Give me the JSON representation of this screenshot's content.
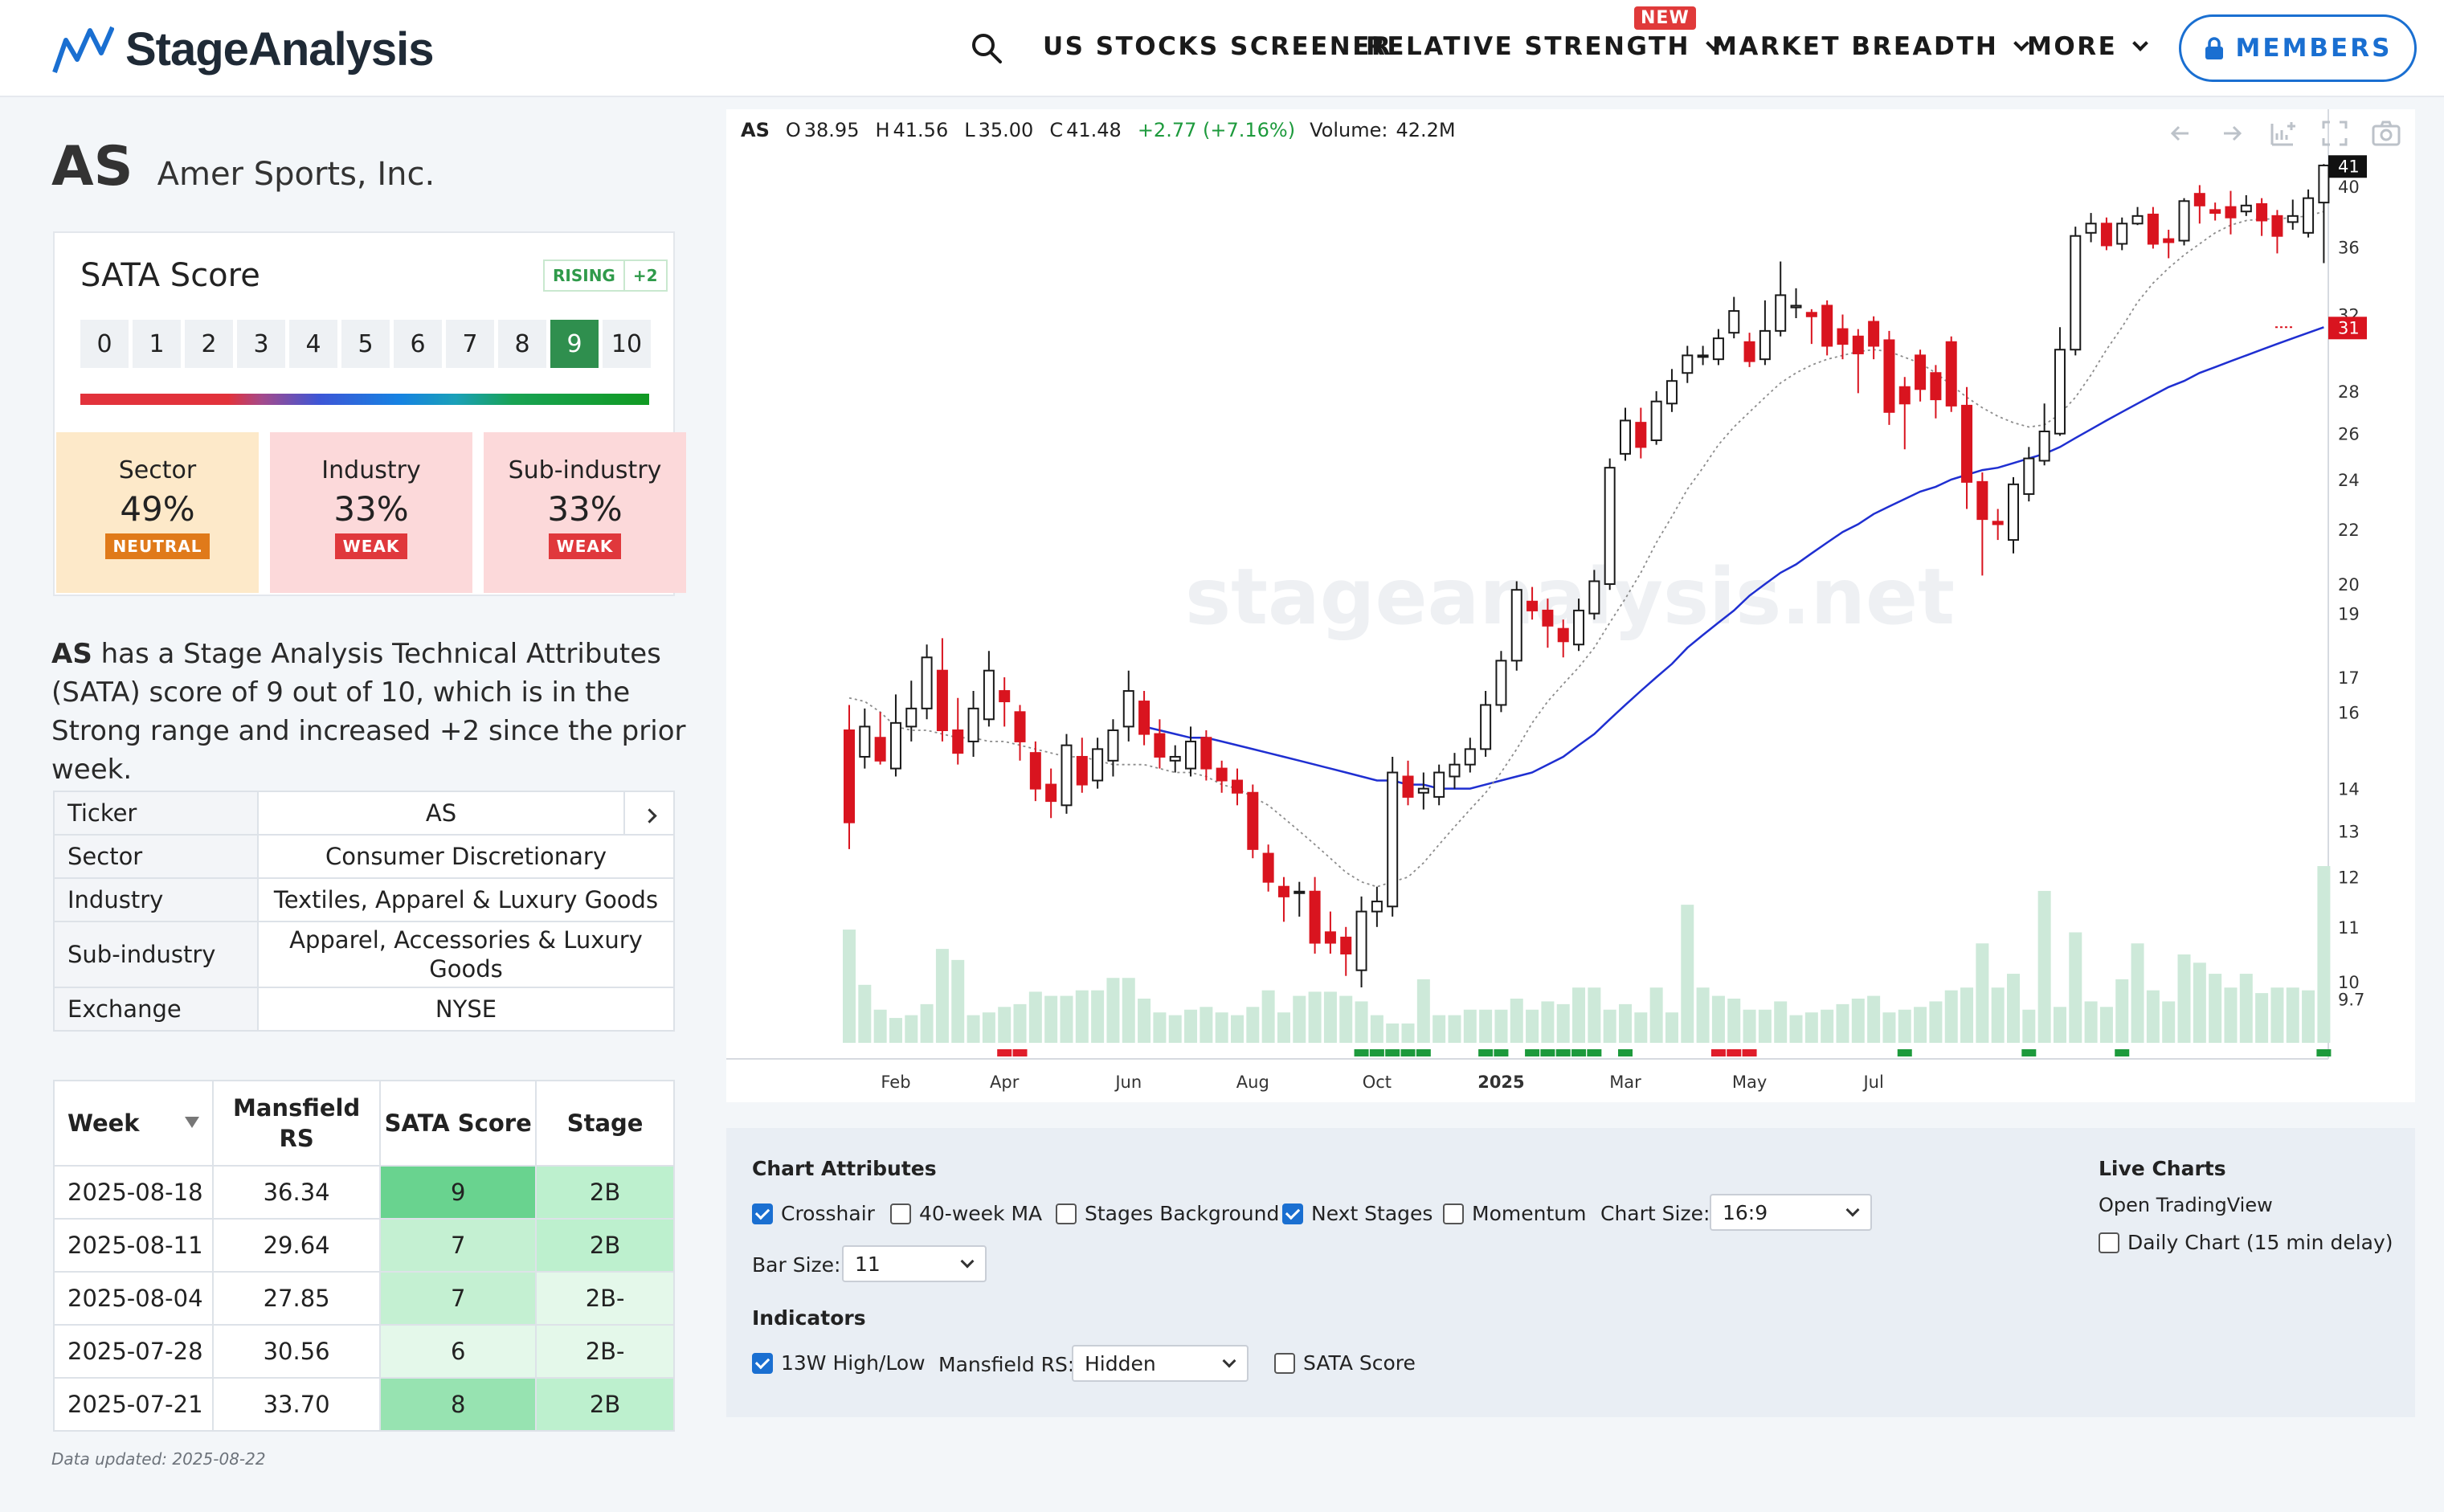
{
  "nav": {
    "logo": "StageAnalysis",
    "items": [
      {
        "label": "US STOCKS SCREENER",
        "has_chevron": false
      },
      {
        "label": "RELATIVE STRENGTH",
        "has_chevron": true,
        "badge": "NEW"
      },
      {
        "label": "MARKET BREADTH",
        "has_chevron": true
      },
      {
        "label": "MORE",
        "has_chevron": true
      }
    ],
    "members": "MEMBERS"
  },
  "ticker": {
    "symbol": "AS",
    "name": "Amer Sports, Inc."
  },
  "sata": {
    "label": "SATA Score",
    "trend": "RISING",
    "trend_change": "+2",
    "scale": [
      "0",
      "1",
      "2",
      "3",
      "4",
      "5",
      "6",
      "7",
      "8",
      "9",
      "10"
    ],
    "score": 9,
    "groups": [
      {
        "name": "Sector",
        "value": "49%",
        "badge": "NEUTRAL",
        "bg": "#fde9c9",
        "badge_color": "#e07a1a"
      },
      {
        "name": "Industry",
        "value": "33%",
        "badge": "WEAK",
        "bg": "#fcd9da",
        "badge_color": "#e0383c"
      },
      {
        "name": "Sub-industry",
        "value": "33%",
        "badge": "WEAK",
        "bg": "#fcd9da",
        "badge_color": "#e0383c"
      }
    ]
  },
  "description": {
    "symbol": "AS",
    "text": " has a Stage Analysis Technical Attributes (SATA) score of 9 out of 10, which is in the Strong range and increased +2 since the prior week."
  },
  "info": [
    {
      "key": "Ticker",
      "value": "AS"
    },
    {
      "key": "Sector",
      "value": "Consumer Discretionary"
    },
    {
      "key": "Industry",
      "value": "Textiles, Apparel & Luxury Goods"
    },
    {
      "key": "Sub-industry",
      "value": "Apparel, Accessories & Luxury Goods"
    },
    {
      "key": "Exchange",
      "value": "NYSE"
    }
  ],
  "weeks": {
    "headers": [
      "Week",
      "Mansfield RS",
      "SATA Score",
      "Stage"
    ],
    "rows": [
      {
        "week": "2025-08-18",
        "rs": "36.34",
        "score": "9",
        "stage": "2B",
        "score_bg": "#69d38f",
        "stage_bg": "#bdf0ce"
      },
      {
        "week": "2025-08-11",
        "rs": "29.64",
        "score": "7",
        "stage": "2B",
        "score_bg": "#c4f0d2",
        "stage_bg": "#bdf0ce"
      },
      {
        "week": "2025-08-04",
        "rs": "27.85",
        "score": "7",
        "stage": "2B-",
        "score_bg": "#c4f0d2",
        "stage_bg": "#e4f8ea"
      },
      {
        "week": "2025-07-28",
        "rs": "30.56",
        "score": "6",
        "stage": "2B-",
        "score_bg": "#e4f8ea",
        "stage_bg": "#e4f8ea"
      },
      {
        "week": "2025-07-21",
        "rs": "33.70",
        "score": "8",
        "stage": "2B",
        "score_bg": "#97e3b1",
        "stage_bg": "#bdf0ce"
      }
    ]
  },
  "data_updated": "Data updated: 2025-08-22",
  "chart": {
    "symbol": "AS",
    "o_label": "O",
    "o": "38.95",
    "h_label": "H",
    "h": "41.56",
    "l_label": "L",
    "l": "35.00",
    "c_label": "C",
    "c": "41.48",
    "change": "+2.77 (+7.16%)",
    "volume_label": "Volume:",
    "volume": "42.2M",
    "watermark": "stageanalysis.net",
    "last_price": "41",
    "ma_label": "31"
  },
  "chart_data": {
    "type": "candlestick",
    "x_ticks": [
      "Feb",
      "Apr",
      "Jun",
      "Aug",
      "Oct",
      "2025",
      "Mar",
      "May",
      "Jul"
    ],
    "y_ticks": [
      41,
      40,
      36,
      32,
      31,
      28,
      26,
      24,
      22,
      20,
      19,
      17,
      16,
      14,
      13,
      12,
      11,
      10,
      9.7
    ],
    "y_scale": "log",
    "candles": [
      [
        15.5,
        13.2,
        16.2,
        12.6
      ],
      [
        14.8,
        15.6,
        16.1,
        14.5
      ],
      [
        15.3,
        14.7,
        16.0,
        14.6
      ],
      [
        14.5,
        15.7,
        16.5,
        14.3
      ],
      [
        15.6,
        16.1,
        16.9,
        15.2
      ],
      [
        16.1,
        17.6,
        18.0,
        15.8
      ],
      [
        17.2,
        15.5,
        18.2,
        15.2
      ],
      [
        15.5,
        14.9,
        16.4,
        14.6
      ],
      [
        15.2,
        16.1,
        16.6,
        14.8
      ],
      [
        15.8,
        17.2,
        17.8,
        15.6
      ],
      [
        16.6,
        16.3,
        17.0,
        15.6
      ],
      [
        16.0,
        15.2,
        16.2,
        14.7
      ],
      [
        14.9,
        14.0,
        15.2,
        13.7
      ],
      [
        14.1,
        13.7,
        14.5,
        13.3
      ],
      [
        13.6,
        15.1,
        15.4,
        13.4
      ],
      [
        14.8,
        14.1,
        15.3,
        13.9
      ],
      [
        14.2,
        15.0,
        15.3,
        14.0
      ],
      [
        14.7,
        15.5,
        15.8,
        14.3
      ],
      [
        15.6,
        16.6,
        17.2,
        15.2
      ],
      [
        16.3,
        15.4,
        16.6,
        15.1
      ],
      [
        15.4,
        14.8,
        15.8,
        14.5
      ],
      [
        14.7,
        14.8,
        15.1,
        14.4
      ],
      [
        14.5,
        15.2,
        15.6,
        14.3
      ],
      [
        15.3,
        14.5,
        15.5,
        14.2
      ],
      [
        14.5,
        14.2,
        14.7,
        13.9
      ],
      [
        14.2,
        13.9,
        14.5,
        13.6
      ],
      [
        13.9,
        12.6,
        14.1,
        12.4
      ],
      [
        12.5,
        11.9,
        12.7,
        11.7
      ],
      [
        11.8,
        11.6,
        12.0,
        11.1
      ],
      [
        11.7,
        11.7,
        11.9,
        11.2
      ],
      [
        11.7,
        10.7,
        12.0,
        10.5
      ],
      [
        10.9,
        10.7,
        11.3,
        10.5
      ],
      [
        10.8,
        10.5,
        11.0,
        10.1
      ],
      [
        10.2,
        11.3,
        11.6,
        9.9
      ],
      [
        11.3,
        11.5,
        11.8,
        11.0
      ],
      [
        11.4,
        14.4,
        14.8,
        11.2
      ],
      [
        14.3,
        13.8,
        14.7,
        13.6
      ],
      [
        13.9,
        14.0,
        14.4,
        13.5
      ],
      [
        13.8,
        14.4,
        14.6,
        13.6
      ],
      [
        14.3,
        14.6,
        14.9,
        14.0
      ],
      [
        14.6,
        15.0,
        15.3,
        14.4
      ],
      [
        15.0,
        16.2,
        16.6,
        14.8
      ],
      [
        16.2,
        17.5,
        17.8,
        16.0
      ],
      [
        17.5,
        19.8,
        20.1,
        17.2
      ],
      [
        19.4,
        19.1,
        19.9,
        18.8
      ],
      [
        19.1,
        18.6,
        19.5,
        17.9
      ],
      [
        18.5,
        18.1,
        18.8,
        17.6
      ],
      [
        18.0,
        19.1,
        19.5,
        17.8
      ],
      [
        19.0,
        20.1,
        20.5,
        18.8
      ],
      [
        20.0,
        24.5,
        24.9,
        19.8
      ],
      [
        25.1,
        26.6,
        27.2,
        24.8
      ],
      [
        26.5,
        25.4,
        27.2,
        24.9
      ],
      [
        25.7,
        27.5,
        28.0,
        25.5
      ],
      [
        27.4,
        28.5,
        29.1,
        27.0
      ],
      [
        28.9,
        29.8,
        30.3,
        28.4
      ],
      [
        29.8,
        29.8,
        30.3,
        29.3
      ],
      [
        29.6,
        30.7,
        31.2,
        29.3
      ],
      [
        31.0,
        32.2,
        33.0,
        30.7
      ],
      [
        30.5,
        29.5,
        31.0,
        29.2
      ],
      [
        29.6,
        31.1,
        32.8,
        29.3
      ],
      [
        31.1,
        33.1,
        35.1,
        30.8
      ],
      [
        32.4,
        32.5,
        33.5,
        31.8
      ],
      [
        32.1,
        31.9,
        32.3,
        30.4
      ],
      [
        32.5,
        30.3,
        32.8,
        29.8
      ],
      [
        31.2,
        30.4,
        32.0,
        29.6
      ],
      [
        30.8,
        29.9,
        31.2,
        27.9
      ],
      [
        31.6,
        30.3,
        31.9,
        29.6
      ],
      [
        30.6,
        27.0,
        31.1,
        26.4
      ],
      [
        28.2,
        27.4,
        28.7,
        25.3
      ],
      [
        29.8,
        28.1,
        30.1,
        27.5
      ],
      [
        28.9,
        27.6,
        29.3,
        26.7
      ],
      [
        30.5,
        27.3,
        30.8,
        27.0
      ],
      [
        27.3,
        23.9,
        28.2,
        22.8
      ],
      [
        23.9,
        22.4,
        24.3,
        20.3
      ],
      [
        22.3,
        22.2,
        22.8,
        21.6
      ],
      [
        21.6,
        23.8,
        24.1,
        21.1
      ],
      [
        23.4,
        24.9,
        25.4,
        23.1
      ],
      [
        24.8,
        26.1,
        27.4,
        24.6
      ],
      [
        26.0,
        30.1,
        31.3,
        25.9
      ],
      [
        30.1,
        36.7,
        37.3,
        29.8
      ],
      [
        36.9,
        37.5,
        38.2,
        36.3
      ],
      [
        37.5,
        36.1,
        37.9,
        35.8
      ],
      [
        36.2,
        37.5,
        37.9,
        35.8
      ],
      [
        37.5,
        38.0,
        38.6,
        37.4
      ],
      [
        38.1,
        36.2,
        38.6,
        35.9
      ],
      [
        36.5,
        36.3,
        37.1,
        35.3
      ],
      [
        36.4,
        39.0,
        39.2,
        36.1
      ],
      [
        39.5,
        38.7,
        40.1,
        37.5
      ],
      [
        38.4,
        38.2,
        38.9,
        37.7
      ],
      [
        38.6,
        37.9,
        39.7,
        36.8
      ],
      [
        38.3,
        38.7,
        39.4,
        38.0
      ],
      [
        38.8,
        37.7,
        39.2,
        36.7
      ],
      [
        38.0,
        36.7,
        38.4,
        35.6
      ],
      [
        37.6,
        38.0,
        39.1,
        37.1
      ],
      [
        36.9,
        39.2,
        39.8,
        36.6
      ],
      [
        38.9,
        41.5,
        41.6,
        35.0
      ]
    ],
    "volume": [
      82,
      42,
      24,
      18,
      20,
      28,
      68,
      60,
      20,
      22,
      26,
      28,
      37,
      34,
      34,
      38,
      38,
      47,
      47,
      32,
      22,
      20,
      24,
      26,
      22,
      20,
      26,
      38,
      22,
      34,
      37,
      37,
      34,
      30,
      20,
      14,
      14,
      46,
      20,
      20,
      24,
      24,
      24,
      32,
      24,
      30,
      28,
      40,
      40,
      24,
      28,
      22,
      40,
      22,
      100,
      40,
      34,
      32,
      24,
      24,
      30,
      20,
      22,
      24,
      28,
      32,
      34,
      22,
      24,
      26,
      30,
      38,
      40,
      72,
      40,
      50,
      24,
      110,
      26,
      80,
      30,
      26,
      46,
      72,
      38,
      30,
      64,
      58,
      50,
      40,
      50,
      36,
      40,
      40,
      38,
      128
    ],
    "bar_volume_scale_max": 128,
    "ma10": [
      16.4,
      16.3,
      16.0,
      15.6,
      15.5,
      15.5,
      15.4,
      15.3,
      15.3,
      15.2,
      15.2,
      15.1,
      15.0,
      14.9,
      14.8,
      14.8,
      14.7,
      14.6,
      14.6,
      14.6,
      14.5,
      14.4,
      14.4,
      14.3,
      14.1,
      14.0,
      13.8,
      13.6,
      13.3,
      13.0,
      12.7,
      12.4,
      12.1,
      11.9,
      11.8,
      11.9,
      12.0,
      12.3,
      12.7,
      13.1,
      13.5,
      13.9,
      14.4,
      15.0,
      15.7,
      16.3,
      16.8,
      17.3,
      17.9,
      18.7,
      19.5,
      20.4,
      21.5,
      22.5,
      23.6,
      24.5,
      25.5,
      26.3,
      27.0,
      27.7,
      28.4,
      28.9,
      29.3,
      29.6,
      29.8,
      30.0,
      30.1,
      30.0,
      29.7,
      29.4,
      28.9,
      28.3,
      27.7,
      27.2,
      26.8,
      26.5,
      26.3,
      26.4,
      26.9,
      27.7,
      28.8,
      30.1,
      31.3,
      32.7,
      33.8,
      34.7,
      35.5,
      36.2,
      36.9,
      37.4,
      37.7,
      37.8,
      37.8,
      37.9,
      38.0,
      38.3
    ],
    "ma30": [
      null,
      null,
      null,
      null,
      null,
      null,
      null,
      null,
      null,
      null,
      null,
      null,
      null,
      null,
      null,
      null,
      null,
      null,
      null,
      15.6,
      15.5,
      15.4,
      15.3,
      15.3,
      15.2,
      15.1,
      15.0,
      14.9,
      14.8,
      14.7,
      14.6,
      14.5,
      14.4,
      14.3,
      14.2,
      14.2,
      14.1,
      14.1,
      14.0,
      14.0,
      14.0,
      14.1,
      14.2,
      14.3,
      14.4,
      14.6,
      14.8,
      15.1,
      15.4,
      15.8,
      16.2,
      16.6,
      17.0,
      17.4,
      17.9,
      18.3,
      18.7,
      19.1,
      19.6,
      20.0,
      20.4,
      20.7,
      21.1,
      21.5,
      21.9,
      22.2,
      22.6,
      22.9,
      23.2,
      23.5,
      23.7,
      24.0,
      24.2,
      24.4,
      24.5,
      24.7,
      24.9,
      25.1,
      25.4,
      25.8,
      26.2,
      26.6,
      27.0,
      27.4,
      27.8,
      28.2,
      28.5,
      28.9,
      29.2,
      29.5,
      29.8,
      30.1,
      30.4,
      30.7,
      31.0,
      31.3
    ],
    "signal_bars": [
      {
        "i": 10,
        "color": "#e01d2a"
      },
      {
        "i": 11,
        "color": "#e01d2a"
      },
      {
        "i": 33,
        "color": "#1d9a3c"
      },
      {
        "i": 34,
        "color": "#1d9a3c"
      },
      {
        "i": 35,
        "color": "#1d9a3c"
      },
      {
        "i": 36,
        "color": "#1d9a3c"
      },
      {
        "i": 37,
        "color": "#1d9a3c"
      },
      {
        "i": 41,
        "color": "#1d9a3c"
      },
      {
        "i": 42,
        "color": "#1d9a3c"
      },
      {
        "i": 44,
        "color": "#1d9a3c"
      },
      {
        "i": 45,
        "color": "#1d9a3c"
      },
      {
        "i": 46,
        "color": "#1d9a3c"
      },
      {
        "i": 47,
        "color": "#1d9a3c"
      },
      {
        "i": 48,
        "color": "#1d9a3c"
      },
      {
        "i": 50,
        "color": "#1d9a3c"
      },
      {
        "i": 56,
        "color": "#e01d2a"
      },
      {
        "i": 57,
        "color": "#e01d2a"
      },
      {
        "i": 58,
        "color": "#e01d2a"
      },
      {
        "i": 68,
        "color": "#1d9a3c"
      },
      {
        "i": 76,
        "color": "#1d9a3c"
      },
      {
        "i": 82,
        "color": "#1d9a3c"
      },
      {
        "i": 95,
        "color": "#1d9a3c"
      }
    ]
  },
  "attributes": {
    "chart_attributes_title": "Chart Attributes",
    "checkboxes": [
      {
        "label": "Crosshair",
        "checked": true
      },
      {
        "label": "40-week MA",
        "checked": false
      },
      {
        "label": "Stages Background",
        "checked": false
      },
      {
        "label": "Next Stages",
        "checked": true
      },
      {
        "label": "Momentum",
        "checked": false
      }
    ],
    "chart_size_label": "Chart Size:",
    "chart_size_value": "16:9",
    "bar_size_label": "Bar Size:",
    "bar_size_value": "11",
    "indicators_title": "Indicators",
    "high_low": {
      "label": "13W High/Low",
      "checked": true
    },
    "mansfield_label": "Mansfield RS:",
    "mansfield_value": "Hidden",
    "sata_score_cb": {
      "label": "SATA Score",
      "checked": false
    },
    "live_charts_title": "Live Charts",
    "open_tradingview": "Open TradingView",
    "daily_chart": {
      "label": "Daily Chart (15 min delay)",
      "checked": false
    }
  }
}
